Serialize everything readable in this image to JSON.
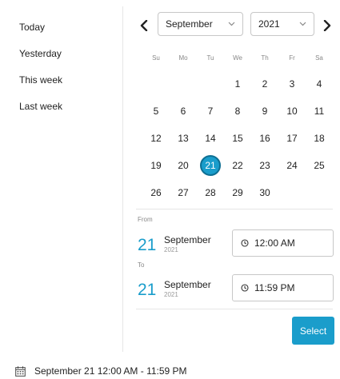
{
  "presets": [
    "Today",
    "Yesterday",
    "This week",
    "Last week"
  ],
  "header": {
    "prev_icon": "chevron-left-icon",
    "next_icon": "chevron-right-icon",
    "month_select": "September",
    "year_select": "2021"
  },
  "weekdays": [
    "Su",
    "Mo",
    "Tu",
    "We",
    "Th",
    "Fr",
    "Sa"
  ],
  "days": [
    "",
    "",
    "",
    "1",
    "2",
    "3",
    "4",
    "5",
    "6",
    "7",
    "8",
    "9",
    "10",
    "11",
    "12",
    "13",
    "14",
    "15",
    "16",
    "17",
    "18",
    "19",
    "20",
    "21",
    "22",
    "23",
    "24",
    "25",
    "26",
    "27",
    "28",
    "29",
    "30",
    "",
    ""
  ],
  "selected_day": "21",
  "from": {
    "label": "From",
    "day": "21",
    "month": "September",
    "year": "2021",
    "time": "12:00 AM"
  },
  "to": {
    "label": "To",
    "day": "21",
    "month": "September",
    "year": "2021",
    "time": "11:59 PM"
  },
  "select_label": "Select",
  "summary_text": "September 21 12:00 AM - 11:59 PM",
  "colors": {
    "accent": "#1a9dcb",
    "accent_border": "#0e6f93",
    "border": "#c7c7c7",
    "divider": "#e6e6e6"
  }
}
